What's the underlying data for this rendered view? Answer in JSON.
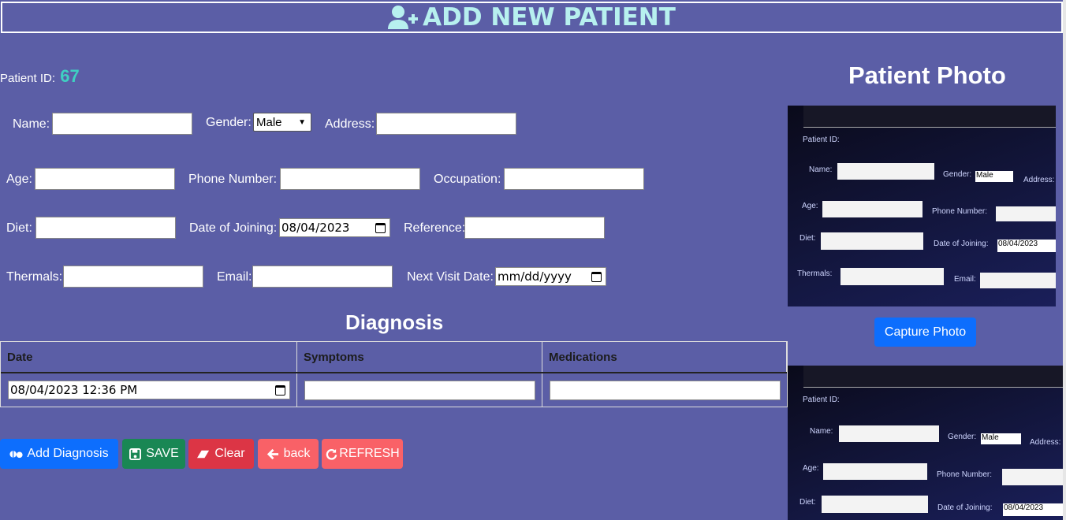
{
  "header": {
    "title": "ADD NEW PATIENT"
  },
  "patient": {
    "id_label": "Patient ID:",
    "id_value": "67"
  },
  "form": {
    "name_label": "Name:",
    "gender_label": "Gender:",
    "gender_value": "Male",
    "address_label": "Address:",
    "age_label": "Age:",
    "phone_label": "Phone Number:",
    "occupation_label": "Occupation:",
    "diet_label": "Diet:",
    "doj_label": "Date of Joining:",
    "doj_value": "08/04/2023",
    "reference_label": "Reference:",
    "thermals_label": "Thermals:",
    "email_label": "Email:",
    "next_visit_label": "Next Visit Date:",
    "next_visit_value": "mm/dd/yyyy"
  },
  "diagnosis": {
    "title": "Diagnosis",
    "columns": [
      "Date",
      "Symptoms",
      "Medications"
    ],
    "row_date": "08/04/2023 12:36  PM"
  },
  "buttons": {
    "add_diagnosis": "Add Diagnosis",
    "save": "SAVE",
    "clear": "Clear",
    "back": "back",
    "refresh": "REFRESH"
  },
  "photo": {
    "title": "Patient Photo",
    "capture": "Capture Photo"
  },
  "colors": {
    "background": "#5b5ea6",
    "header_text": "#b7f0ef",
    "patient_id": "#3fd0c2",
    "primary": "#0d6efd",
    "success": "#198754",
    "danger": "#dc3545",
    "coral": "#f96167"
  }
}
